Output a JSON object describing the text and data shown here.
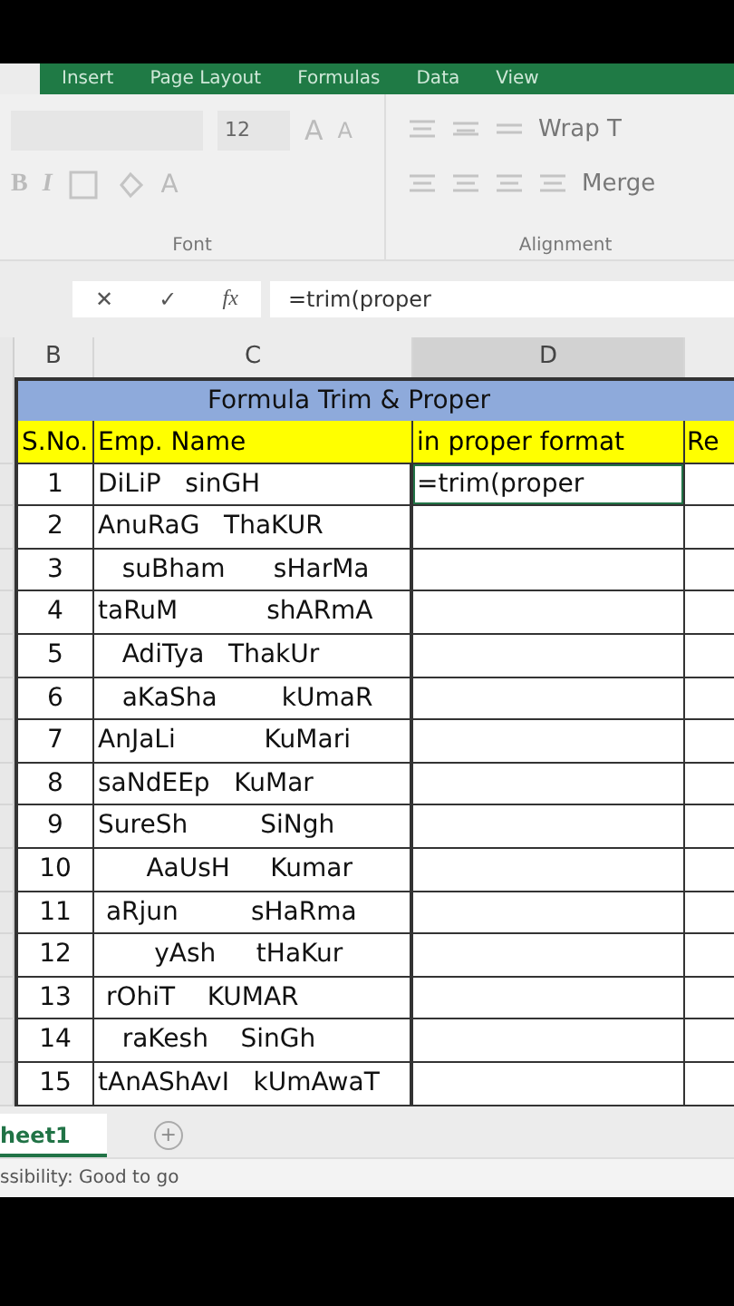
{
  "ribbon_tabs": [
    {
      "label": "Insert",
      "selected": false
    },
    {
      "label": "Page Layout",
      "selected": false
    },
    {
      "label": "Formulas",
      "selected": false
    },
    {
      "label": "Data",
      "selected": false
    },
    {
      "label": "View",
      "selected": false
    }
  ],
  "ribbon": {
    "font_size": "12",
    "grow_font": "A",
    "shrink_font": "A",
    "bold": "B",
    "italic": "I",
    "font_color": "A",
    "wrap_text": "Wrap T",
    "merge": "Merge",
    "font_group": "Font",
    "alignment_group": "Alignment"
  },
  "formula_bar": {
    "cancel": "✕",
    "enter": "✓",
    "function": "fx",
    "value": "=trim(proper"
  },
  "columns": [
    {
      "label": "B",
      "selected": false
    },
    {
      "label": "C",
      "selected": false
    },
    {
      "label": "D",
      "selected": true
    }
  ],
  "sheet": {
    "title": "Formula Trim & Proper",
    "headers": [
      "S.No.",
      "Emp. Name",
      "in proper format",
      "Re"
    ],
    "rows": [
      {
        "sno": "1",
        "name": "DiLiP   sinGH",
        "result": "=trim(proper",
        "active": true
      },
      {
        "sno": "2",
        "name": "AnuRaG   ThaKUR",
        "active": false
      },
      {
        "sno": "3",
        "name": "   suBham      sHarMa",
        "active": false
      },
      {
        "sno": "4",
        "name": "taRuM           shARmA",
        "active": false
      },
      {
        "sno": "5",
        "name": "   AdiTya   ThakUr",
        "active": false
      },
      {
        "sno": "6",
        "name": "   aKaSha        kUmaR",
        "active": false
      },
      {
        "sno": "7",
        "name": "AnJaLi           KuMari",
        "active": false
      },
      {
        "sno": "8",
        "name": "saNdEEp   KuMar",
        "active": false
      },
      {
        "sno": "9",
        "name": "SureSh         SiNgh",
        "active": false
      },
      {
        "sno": "10",
        "name": "      AaUsH     Kumar",
        "active": false
      },
      {
        "sno": "11",
        "name": " aRjun         sHaRma",
        "active": false
      },
      {
        "sno": "12",
        "name": "       yAsh     tHaKur",
        "active": false
      },
      {
        "sno": "13",
        "name": " rOhiT    KUMAR",
        "active": false
      },
      {
        "sno": "14",
        "name": "   raKesh    SinGh",
        "active": false
      },
      {
        "sno": "15",
        "name": "tAnAShAvI   kUmAwaT",
        "active": false
      }
    ]
  },
  "sheet_tabs": [
    {
      "label": "heet1",
      "selected": true
    }
  ],
  "new_sheet": "+",
  "status_bar": "ssibility: Good to go"
}
